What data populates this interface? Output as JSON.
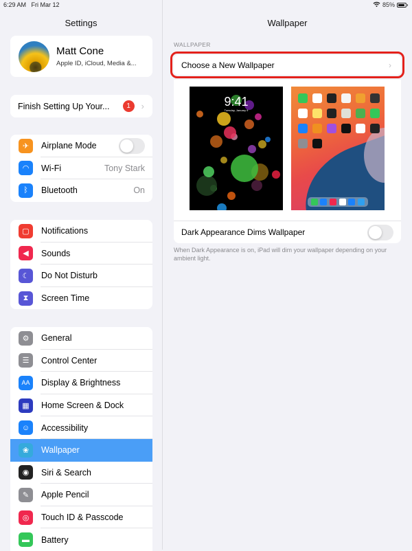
{
  "status_bar": {
    "time": "6:29 AM",
    "date": "Fri Mar 12",
    "battery": "85%",
    "battery_level": 0.85
  },
  "sidebar": {
    "title": "Settings",
    "profile": {
      "name": "Matt Cone",
      "subtitle": "Apple ID, iCloud, Media &..."
    },
    "finish_setup": {
      "label": "Finish Setting Up Your...",
      "badge": "1"
    },
    "groups": [
      [
        {
          "label": "Airplane Mode",
          "icon": "airplane-icon",
          "color": "#f7931f",
          "toggle": false
        },
        {
          "label": "Wi-Fi",
          "icon": "wifi-icon",
          "color": "#1a82fb",
          "value": "Tony Stark"
        },
        {
          "label": "Bluetooth",
          "icon": "bluetooth-icon",
          "color": "#1a82fb",
          "value": "On"
        }
      ],
      [
        {
          "label": "Notifications",
          "icon": "notifications-icon",
          "color": "#f03c31"
        },
        {
          "label": "Sounds",
          "icon": "sounds-icon",
          "color": "#f0284e"
        },
        {
          "label": "Do Not Disturb",
          "icon": "moon-icon",
          "color": "#5856d6"
        },
        {
          "label": "Screen Time",
          "icon": "hourglass-icon",
          "color": "#5856d6"
        }
      ],
      [
        {
          "label": "General",
          "icon": "gear-icon",
          "color": "#8e8e93"
        },
        {
          "label": "Control Center",
          "icon": "switches-icon",
          "color": "#8e8e93"
        },
        {
          "label": "Display & Brightness",
          "icon": "text-size-icon",
          "color": "#1a82fb"
        },
        {
          "label": "Home Screen & Dock",
          "icon": "app-grid-icon",
          "color": "#2d3bbf"
        },
        {
          "label": "Accessibility",
          "icon": "accessibility-icon",
          "color": "#1a82fb"
        },
        {
          "label": "Wallpaper",
          "icon": "flower-icon",
          "color": "#35aadc",
          "selected": true
        },
        {
          "label": "Siri & Search",
          "icon": "siri-icon",
          "color": "#222"
        },
        {
          "label": "Apple Pencil",
          "icon": "pencil-icon",
          "color": "#8e8e93"
        },
        {
          "label": "Touch ID & Passcode",
          "icon": "fingerprint-icon",
          "color": "#f0284e"
        },
        {
          "label": "Battery",
          "icon": "battery-icon",
          "color": "#34c759"
        }
      ]
    ]
  },
  "detail": {
    "title": "Wallpaper",
    "section_header": "WALLPAPER",
    "choose_label": "Choose a New Wallpaper",
    "lock_preview": {
      "time": "9:41",
      "date": "Tuesday, January 9"
    },
    "dims_label": "Dark Appearance Dims Wallpaper",
    "dims_toggle": false,
    "footnote": "When Dark Appearance is on, iPad will dim your wallpaper depending on your ambient light."
  }
}
